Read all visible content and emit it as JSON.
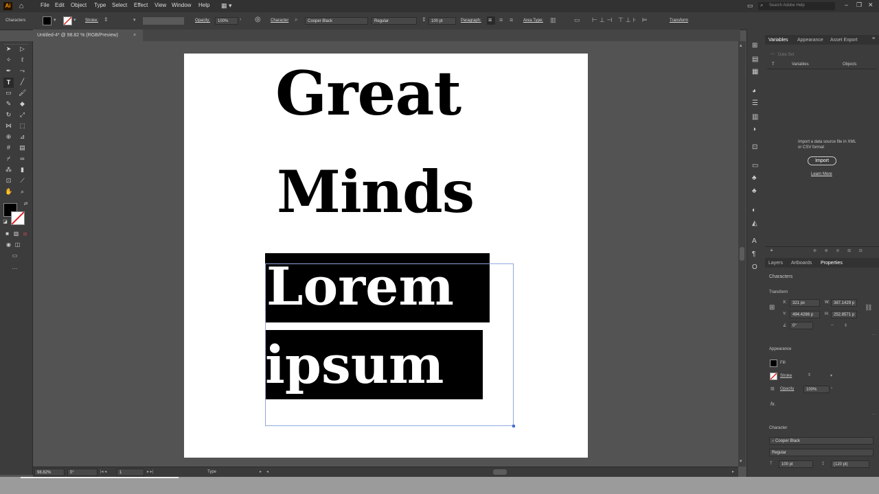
{
  "menubar": {
    "logo": "Ai",
    "items": [
      "File",
      "Edit",
      "Object",
      "Type",
      "Select",
      "Effect",
      "View",
      "Window",
      "Help"
    ],
    "search_placeholder": "Search Adobe Help"
  },
  "control": {
    "panel_label": "Characters",
    "stroke_label": "Stroke:",
    "opacity_label": "Opacity:",
    "opacity_value": "100%",
    "character_label": "Character",
    "font_family": "Cooper Black",
    "font_style": "Regular",
    "font_size": "100 pt",
    "paragraph_label": "Paragraph:",
    "area_type_label": "Area Type:",
    "transform_label": "Transform"
  },
  "document_tab": {
    "title": "Untitled-4* @ 98.82 % (RGB/Preview)",
    "close": "×"
  },
  "artwork": {
    "line1": "Great",
    "line2": "Minds",
    "line3": "Lorem",
    "line4": "ipsum"
  },
  "right_panel_top": {
    "tabs": [
      "Variables",
      "Appearance",
      "Asset Export"
    ],
    "data_set": "Data Set",
    "col_variables": "Variables",
    "col_objects": "Objects",
    "import_message": "Import a data source file in XML or CSV format",
    "import_button": "Import",
    "learn_more": "Learn More"
  },
  "right_panel_bottom": {
    "tabs": [
      "Layers",
      "Artboards",
      "Properties"
    ],
    "section_characters": "Characters",
    "section_transform": "Transform",
    "x_label": "X:",
    "x_value": "321 px",
    "w_label": "W:",
    "w_value": "387.1429 p",
    "y_label": "Y:",
    "y_value": "494.4286 p",
    "h_label": "H:",
    "h_value": "252.8571 p",
    "angle_value": "0°",
    "section_appearance": "Appearance",
    "fill_label": "Fill",
    "stroke_label": "Stroke",
    "opacity_label": "Opacity",
    "opacity_value": "100%",
    "fx_label": "fx.",
    "section_character": "Character",
    "font_family": "Cooper Black",
    "font_style": "Regular",
    "font_size": "100 pt",
    "leading": "(120 pt)"
  },
  "statusbar": {
    "zoom": "98.82%",
    "rotation": "0°",
    "artboard_num": "1",
    "tool_name": "Type"
  },
  "colors": {
    "accent_orange": "#ff9a00",
    "ui_dark": "#323232",
    "ui_mid": "#3c3c3c",
    "canvas": "#535353"
  }
}
